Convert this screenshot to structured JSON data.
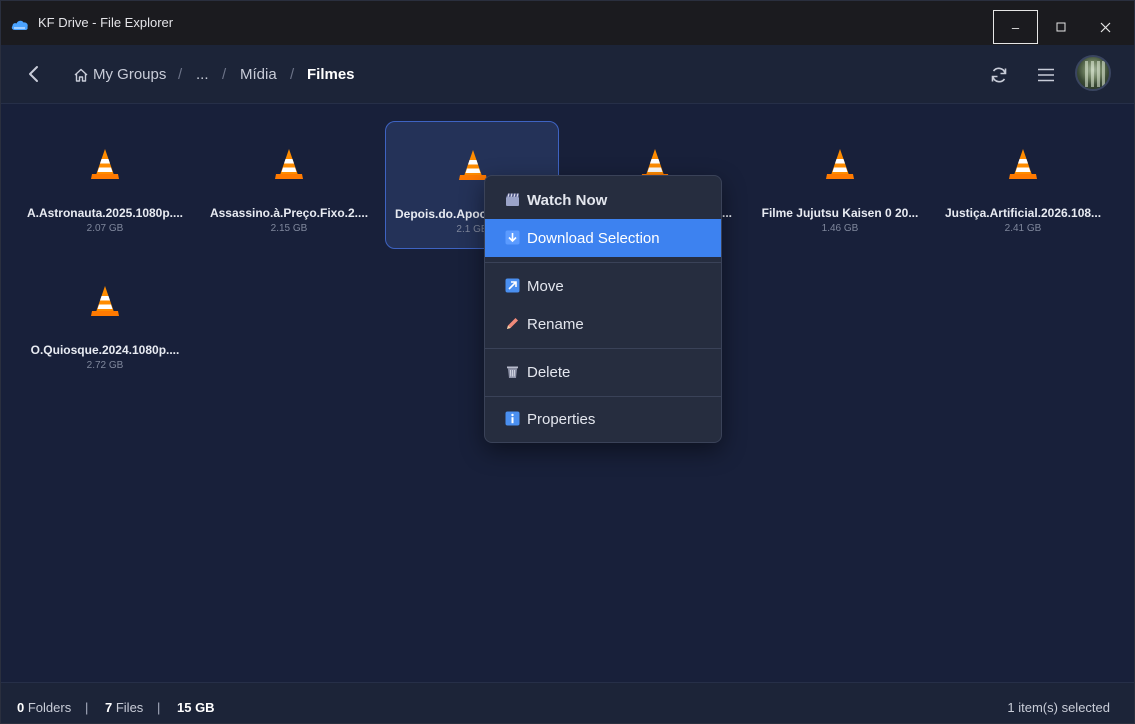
{
  "window": {
    "title": "KF Drive - File Explorer",
    "controls": {
      "minimize": "–",
      "maximize": "□",
      "close": "✕"
    }
  },
  "breadcrumb": {
    "items": [
      "My Groups",
      "...",
      "Mídia",
      "Filmes"
    ],
    "separator": "/"
  },
  "files": [
    {
      "name": "A.Astronauta.2025.1080p....",
      "size": "2.07 GB",
      "selected": false
    },
    {
      "name": "Assassino.à.Preço.Fixo.2....",
      "size": "2.15 GB",
      "selected": false
    },
    {
      "name": "Depois.do.Apoc",
      "size": "2.1 GB",
      "selected": true
    },
    {
      "name": "...",
      "size": "",
      "selected": false
    },
    {
      "name": "Filme Jujutsu Kaisen 0 20...",
      "size": "1.46 GB",
      "selected": false
    },
    {
      "name": "Justiça.Artificial.2026.108...",
      "size": "2.41 GB",
      "selected": false
    },
    {
      "name": "O.Quiosque.2024.1080p....",
      "size": "2.72 GB",
      "selected": false
    }
  ],
  "context_menu": {
    "items": [
      {
        "label": "Watch Now",
        "icon": "clapper-icon"
      },
      {
        "label": "Download Selection",
        "icon": "download-arrow-icon"
      },
      {
        "label": "Move",
        "icon": "move-arrow-icon"
      },
      {
        "label": "Rename",
        "icon": "pencil-icon"
      },
      {
        "label": "Delete",
        "icon": "trash-icon"
      },
      {
        "label": "Properties",
        "icon": "info-icon"
      }
    ]
  },
  "status": {
    "folders_count": "0",
    "folders_label": " Folders",
    "files_count": "7",
    "files_label": " Files",
    "total_size": "15 GB",
    "sep": "|",
    "selection": "1 item(s) selected"
  },
  "colors": {
    "accent": "#3d82f0",
    "background": "#18203a",
    "menu": "#262d3f"
  }
}
